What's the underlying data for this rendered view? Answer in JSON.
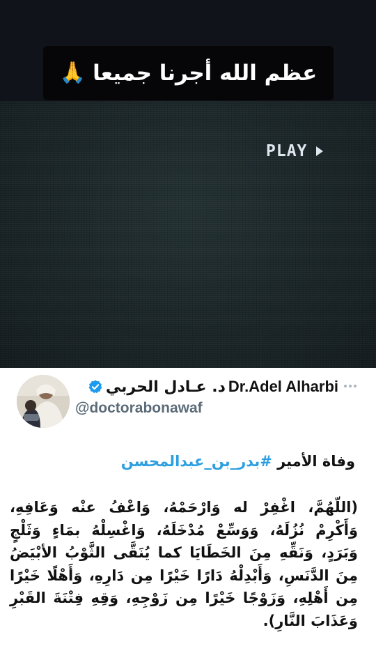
{
  "caption": {
    "text": "عظم الله أجرنا جميعا",
    "emoji": "🙏",
    "emoji_icon": "folded-hands-emoji"
  },
  "video": {
    "status_label": "PLAY",
    "status_icon": "play-triangle-icon"
  },
  "tweet": {
    "author_name_en": "Dr.Adel Alharbi",
    "author_name_ar": "د. عـادل الحربي",
    "handle": "@doctorabonawaf",
    "verified": true,
    "verified_color": "#1d9bf0",
    "line1_prefix": "وفاة الأمير",
    "hashtag": "#بدر_بن_عبدالمحسن",
    "hashtag_color": "#2d9fe0",
    "body": "(اللّهُمَّ، اغْفِرْ له وَارْحَمْهُ، وَاعْفُ عنْه وَعَافِهِ، وَأَكْرِمْ نُزُلَهُ، وَوَسِّعْ مُدْخَلَهُ، وَاغْسِلْهُ بمَاءٍ وَثَلْجٍ وَبَرَدٍ، وَنَقِّهِ مِنَ الخَطَايَا كما يُنَقَّى الثَّوْبُ الأبْيَضُ مِنَ الدَّنَسِ، وَأَبْدِلْهُ دَارًا خَيْرًا مِن دَارِهِ، وَأَهْلًا خَيْرًا مِن أَهْلِهِ، وَزَوْجًا خَيْرًا مِن زَوْجِهِ، وَقِهِ فِتْنَةَ القَبْرِ وَعَذَابَ النَّارِ)."
  }
}
